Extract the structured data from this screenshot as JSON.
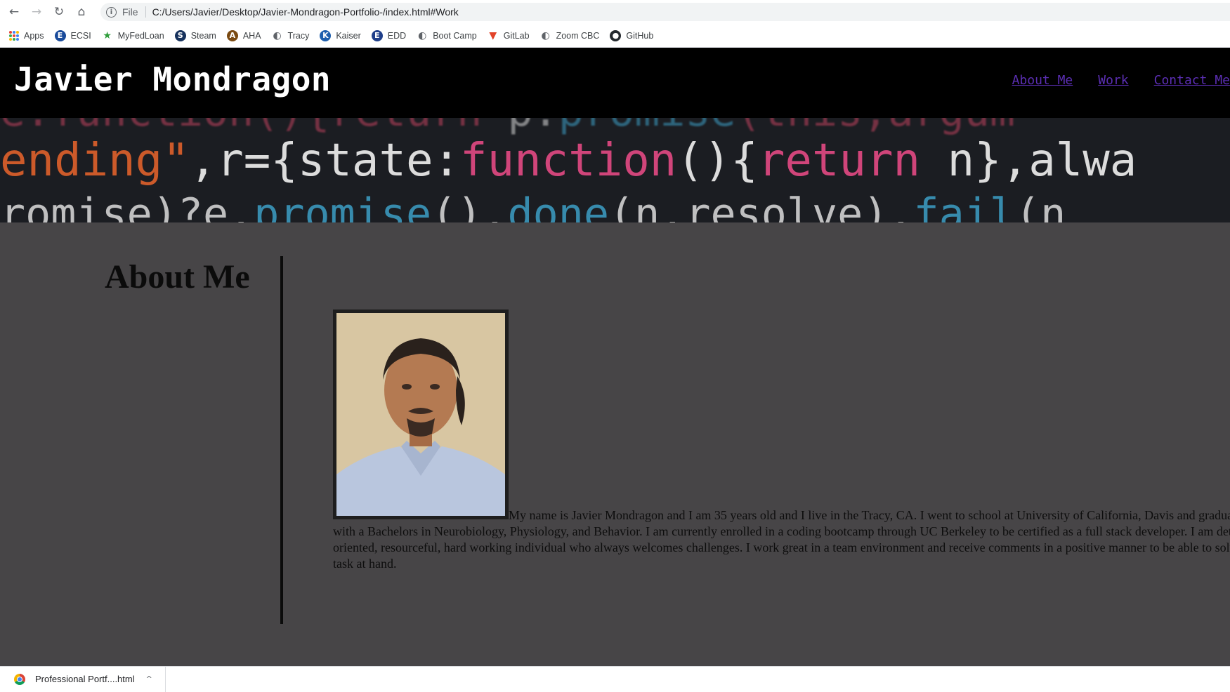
{
  "browser": {
    "back_glyph": "←",
    "forward_glyph": "→",
    "reload_glyph": "↻",
    "home_glyph": "⌂",
    "info_glyph": "i",
    "scheme_label": "File",
    "url": "C:/Users/Javier/Desktop/Javier-Mondragon-Portfolio-/index.html#Work"
  },
  "bookmarks": [
    {
      "label": "Apps",
      "icon": "apps-grid-icon"
    },
    {
      "label": "ECSI",
      "icon": "ecsi-icon",
      "glyph": "E",
      "color": "#1a4b9b"
    },
    {
      "label": "MyFedLoan",
      "icon": "star-icon",
      "glyph": "★",
      "color": "#2e9d3a"
    },
    {
      "label": "Steam",
      "icon": "steam-icon",
      "glyph": "S",
      "color": "#17325d"
    },
    {
      "label": "AHA",
      "icon": "aha-icon",
      "glyph": "A",
      "color": "#7a4a12"
    },
    {
      "label": "Tracy",
      "icon": "globe-icon",
      "glyph": "◐",
      "color": "#5f6368"
    },
    {
      "label": "Kaiser",
      "icon": "kaiser-icon",
      "glyph": "K",
      "color": "#1f5fad"
    },
    {
      "label": "EDD",
      "icon": "edd-icon",
      "glyph": "E",
      "color": "#1f3f8a"
    },
    {
      "label": "Boot Camp",
      "icon": "globe-icon",
      "glyph": "◐",
      "color": "#5f6368"
    },
    {
      "label": "GitLab",
      "icon": "gitlab-icon",
      "glyph": "▼",
      "color": "#e24329"
    },
    {
      "label": "Zoom CBC",
      "icon": "globe-icon",
      "glyph": "◐",
      "color": "#5f6368"
    },
    {
      "label": "GitHub",
      "icon": "github-icon",
      "glyph": "●",
      "color": "#24292e"
    }
  ],
  "site": {
    "title": "Javier Mondragon",
    "nav": [
      "About Me",
      "Work",
      "Contact Me"
    ]
  },
  "hero_code": {
    "line1": [
      {
        "text": "e.function(){return ",
        "color": "#c0425e"
      },
      {
        "text": "p.",
        "color": "#d8d8d8"
      },
      {
        "text": "promise",
        "color": "#3d9fc6"
      },
      {
        "text": "(this,argum",
        "color": "#c0425e"
      }
    ],
    "line2": [
      {
        "text": "ending\"",
        "color": "#cc5a2a"
      },
      {
        "text": ",r={state:",
        "color": "#dcdcdc"
      },
      {
        "text": "function",
        "color": "#d0457a"
      },
      {
        "text": "(){",
        "color": "#dcdcdc"
      },
      {
        "text": "return",
        "color": "#d0457a"
      },
      {
        "text": " n},alwa",
        "color": "#dcdcdc"
      }
    ],
    "line3": [
      {
        "text": "romise)?e.",
        "color": "#dcdcdc"
      },
      {
        "text": "promise",
        "color": "#3d9fc6"
      },
      {
        "text": "().",
        "color": "#dcdcdc"
      },
      {
        "text": "done",
        "color": "#3d9fc6"
      },
      {
        "text": "(n.resolve).",
        "color": "#dcdcdc"
      },
      {
        "text": "fail",
        "color": "#3d9fc6"
      },
      {
        "text": "(n",
        "color": "#dcdcdc"
      }
    ]
  },
  "about": {
    "heading": "About Me",
    "bio": "My name is Javier Mondragon and I am 35 years old and I live in the Tracy, CA. I went to school at University of California, Davis and graduated with a Bachelors in Neurobiology, Physiology, and Behavior. I am currently enrolled in a coding bootcamp through UC Berkeley to be certified as a full stack developer. I am detailed oriented, resourceful, hard working individual who always welcomes challenges. I work great in a team environment and receive comments in a positive manner to be able to solve the task at hand."
  },
  "downloads": {
    "file_name": "Professional Portf....html",
    "chevron_glyph": "^"
  }
}
